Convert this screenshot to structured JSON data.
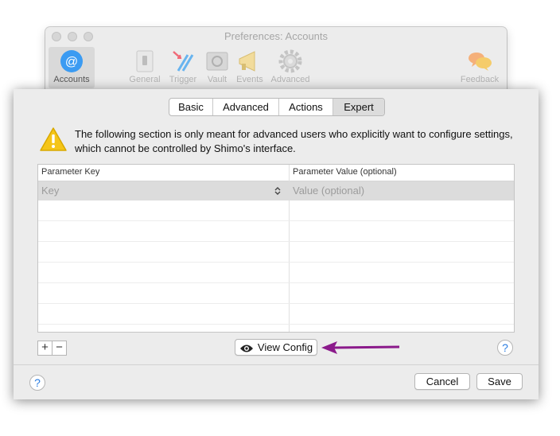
{
  "window": {
    "title": "Preferences: Accounts"
  },
  "toolbar": {
    "items": [
      {
        "label": "Accounts",
        "icon": "at-sign-icon",
        "active": true
      },
      {
        "label": "General",
        "icon": "switch-icon"
      },
      {
        "label": "Trigger",
        "icon": "trigger-icon"
      },
      {
        "label": "Vault",
        "icon": "safe-icon"
      },
      {
        "label": "Events",
        "icon": "megaphone-icon"
      },
      {
        "label": "Advanced",
        "icon": "gear-icon"
      },
      {
        "label": "Feedback",
        "icon": "speech-bubbles-icon"
      }
    ]
  },
  "tabs": {
    "items": [
      {
        "label": "Basic"
      },
      {
        "label": "Advanced"
      },
      {
        "label": "Actions"
      },
      {
        "label": "Expert",
        "selected": true
      }
    ]
  },
  "warning": {
    "icon": "warning-triangle-icon",
    "text": "The following section is only meant for advanced users who explicitly want to configure settings, which cannot be controlled by Shimo's interface."
  },
  "table": {
    "columns": [
      "Parameter Key",
      "Parameter Value (optional)"
    ],
    "key_placeholder": "Key",
    "value_placeholder": "Value (optional)"
  },
  "controls": {
    "add": "+",
    "remove": "−",
    "view_config": "View Config",
    "help": "?",
    "cancel": "Cancel",
    "save": "Save"
  },
  "colors": {
    "accent_blue": "#2a7de1",
    "annotation_arrow": "#8b1a8b",
    "warning_yellow": "#f5c518"
  }
}
